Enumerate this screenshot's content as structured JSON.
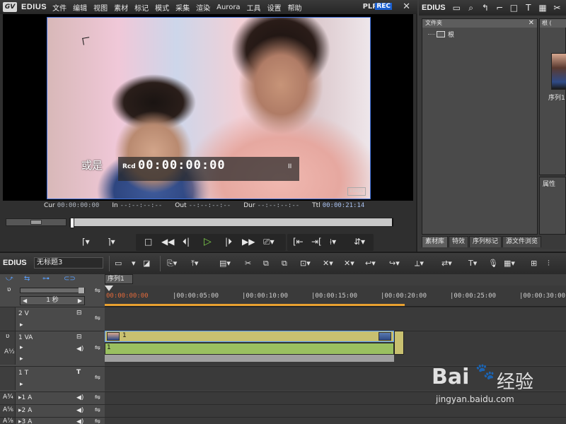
{
  "player": {
    "brand": "EDIUS",
    "menu": [
      "文件",
      "编辑",
      "视图",
      "素材",
      "标记",
      "模式",
      "采集",
      "渲染",
      "Aurora",
      "工具",
      "设置",
      "帮助"
    ],
    "plr": "PLR",
    "rec": "REC",
    "close": "✕",
    "subtitle": "或是",
    "tc_label": "Rcd",
    "tc_value": "00:00:00:00",
    "tc_pause": "II",
    "watermark": "EDIUS",
    "timecodes": [
      {
        "key": "Cur",
        "value": "00:00:00:00",
        "blue": false
      },
      {
        "key": "In",
        "value": "--:--:--:--",
        "blue": false
      },
      {
        "key": "Out",
        "value": "--:--:--:--",
        "blue": false
      },
      {
        "key": "Dur",
        "value": "--:--:--:--",
        "blue": false
      },
      {
        "key": "Ttl",
        "value": "00:00:21:14",
        "blue": true
      }
    ],
    "scrub_position_fraction": 0.0
  },
  "bin": {
    "brand": "EDIUS",
    "folder_header": "文件夹",
    "folder_close": "✕",
    "root_label": "根",
    "clip_header": "根 (",
    "clip_label": "序列1",
    "property_header": "属性",
    "tabs": [
      "素材库",
      "特效",
      "序列标记",
      "源文件浏览"
    ]
  },
  "timeline": {
    "brand": "EDIUS",
    "project_name": "无标题3",
    "sequence_tab": "序列1",
    "zoom_label": "1 秒",
    "ruler_labels": [
      "00:00:00:00",
      "|00:00:05:00",
      "|00:00:10:00",
      "|00:00:15:00",
      "|00:00:20:00",
      "|00:00:25:00",
      "|00:00:30:00"
    ],
    "tracks": [
      {
        "name": "2 V",
        "kind": "video"
      },
      {
        "name": "1 VA",
        "kind": "videoaudio"
      },
      {
        "name": "1 T",
        "kind": "title"
      },
      {
        "name": "▸1 A",
        "kind": "audio",
        "side": "A3/4"
      },
      {
        "name": "▸2 A",
        "kind": "audio",
        "side": "A5/6"
      },
      {
        "name": "▸3 A",
        "kind": "audio",
        "side": "A7/8"
      }
    ],
    "clip_video_label": "1",
    "clip_audio_label": "1"
  },
  "watermark": {
    "text": "Bai",
    "text2": "经验",
    "sub": "jingyan.baidu.com"
  },
  "colors": {
    "accent_blue": "#3e6fd8",
    "rec_blue": "#1a5fd0",
    "play_green": "#7ed04a",
    "clip_video": "#c8c070",
    "clip_audio": "#9ac060",
    "ruler_orange": "#e8a030"
  }
}
